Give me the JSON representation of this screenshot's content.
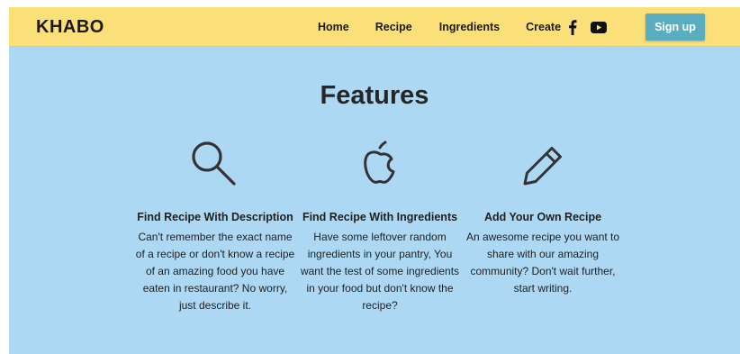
{
  "nav": {
    "brand": "KHABO",
    "links": [
      "Home",
      "Recipe",
      "Ingredients",
      "Create"
    ],
    "social_icons": [
      "facebook-icon",
      "youtube-icon"
    ],
    "signup_label": "Sign up"
  },
  "features": {
    "title": "Features",
    "cards": [
      {
        "icon": "search-icon",
        "title": "Find Recipe With Description",
        "description": "Can't remember the exact name of a recipe or don't know a recipe of an amazing food you have eaten in restaurant? No worry, just describe it."
      },
      {
        "icon": "apple-icon",
        "title": "Find Recipe With Ingredients",
        "description": "Have some leftover random ingredients in your pantry, You want the test of some ingredients in your food but don't know the recipe?"
      },
      {
        "icon": "pencil-icon",
        "title": "Add Your Own Recipe",
        "description": "An awesome recipe you want to share with our amazing community? Don't wait further, start writing."
      }
    ]
  },
  "colors": {
    "navbar_bg": "#fbe07a",
    "section_bg": "#acd8f4",
    "signup_bg": "#5aadbf"
  }
}
